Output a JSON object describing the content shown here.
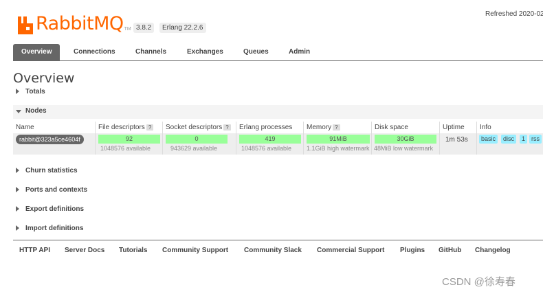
{
  "header": {
    "logo_text": "RabbitMQ",
    "logo_tm": "TM",
    "version": "3.8.2",
    "erlang_version": "Erlang 22.2.6",
    "refreshed": "Refreshed 2020-02"
  },
  "tabs": [
    "Overview",
    "Connections",
    "Channels",
    "Exchanges",
    "Queues",
    "Admin"
  ],
  "page_title": "Overview",
  "sections": {
    "totals": "Totals",
    "nodes": "Nodes",
    "churn": "Churn statistics",
    "ports": "Ports and contexts",
    "export": "Export definitions",
    "import": "Import definitions"
  },
  "nodes_table": {
    "headers": [
      "Name",
      "File descriptors",
      "Socket descriptors",
      "Erlang processes",
      "Memory",
      "Disk space",
      "Uptime",
      "Info"
    ],
    "help": "?",
    "row": {
      "name": "rabbit@323a5ce4604f",
      "file_descriptors": "92",
      "file_descriptors_available": "1048576 available",
      "socket_descriptors": "0",
      "socket_descriptors_available": "943629 available",
      "erlang_processes": "419",
      "erlang_processes_available": "1048576 available",
      "memory": "91MiB",
      "memory_watermark": "1.1GiB high watermark",
      "disk_space": "30GiB",
      "disk_watermark": "48MiB low watermark",
      "uptime": "1m 53s",
      "info_tags": [
        "basic",
        "disc",
        "1",
        "rss"
      ]
    }
  },
  "footer": [
    "HTTP API",
    "Server Docs",
    "Tutorials",
    "Community Support",
    "Community Slack",
    "Commercial Support",
    "Plugins",
    "GitHub",
    "Changelog"
  ],
  "watermark": "CSDN @徐寿春",
  "colors": {
    "brand": "#ff6600",
    "bar": "#99ff99",
    "info_tag": "#99eeff",
    "tab_active": "#666666"
  }
}
